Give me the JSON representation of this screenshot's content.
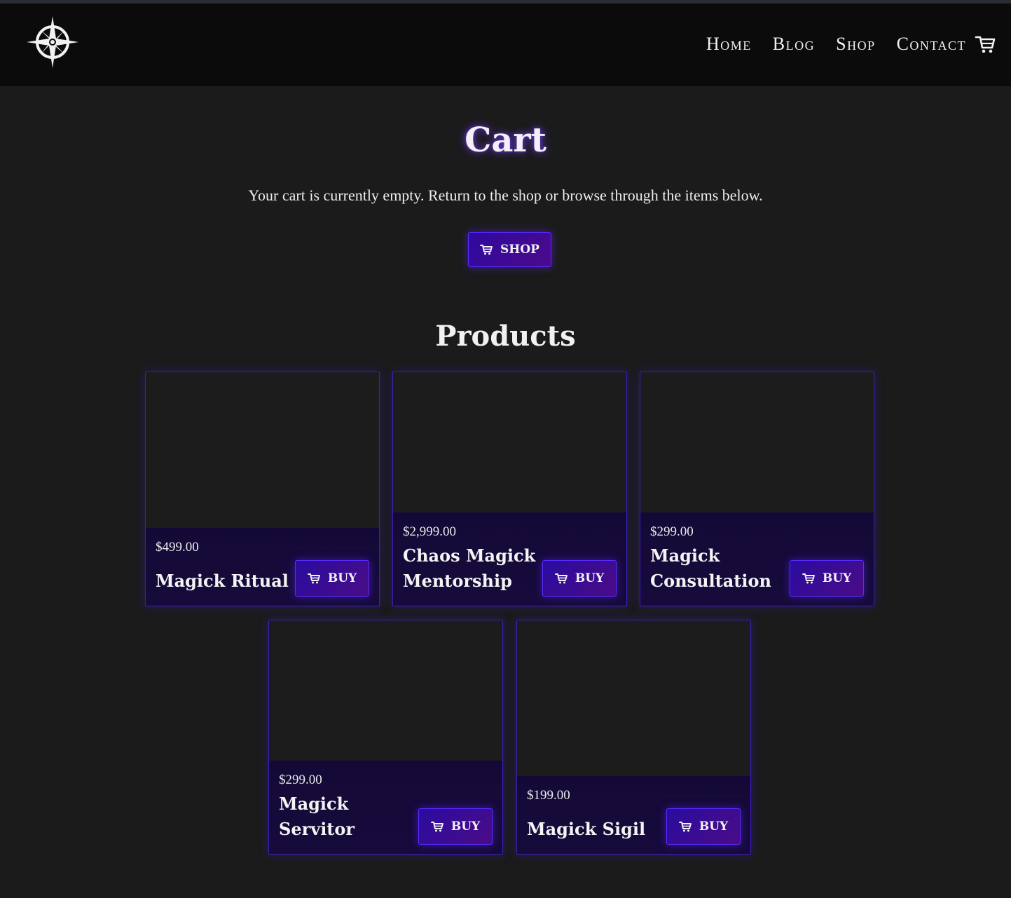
{
  "header": {
    "nav": [
      {
        "label": "Home"
      },
      {
        "label": "Blog"
      },
      {
        "label": "Shop"
      },
      {
        "label": "Contact"
      }
    ]
  },
  "cart": {
    "title": "Cart",
    "empty_message": "Your cart is currently empty. Return to the shop or browse through the items below.",
    "shop_button": "SHOP"
  },
  "products": {
    "title": "Products",
    "buy_label": "BUY",
    "items": [
      {
        "price": "$499.00",
        "name": "Magick Ritual"
      },
      {
        "price": "$2,999.00",
        "name": "Chaos Magick Mentorship"
      },
      {
        "price": "$299.00",
        "name": "Magick Consultation"
      },
      {
        "price": "$299.00",
        "name": "Magick Servitor"
      },
      {
        "price": "$199.00",
        "name": "Magick Sigil"
      }
    ]
  },
  "colors": {
    "accent": "#3b1fb8",
    "button": "#2c0a9e",
    "background": "#1b1b1b",
    "header": "#0b0b0b"
  }
}
